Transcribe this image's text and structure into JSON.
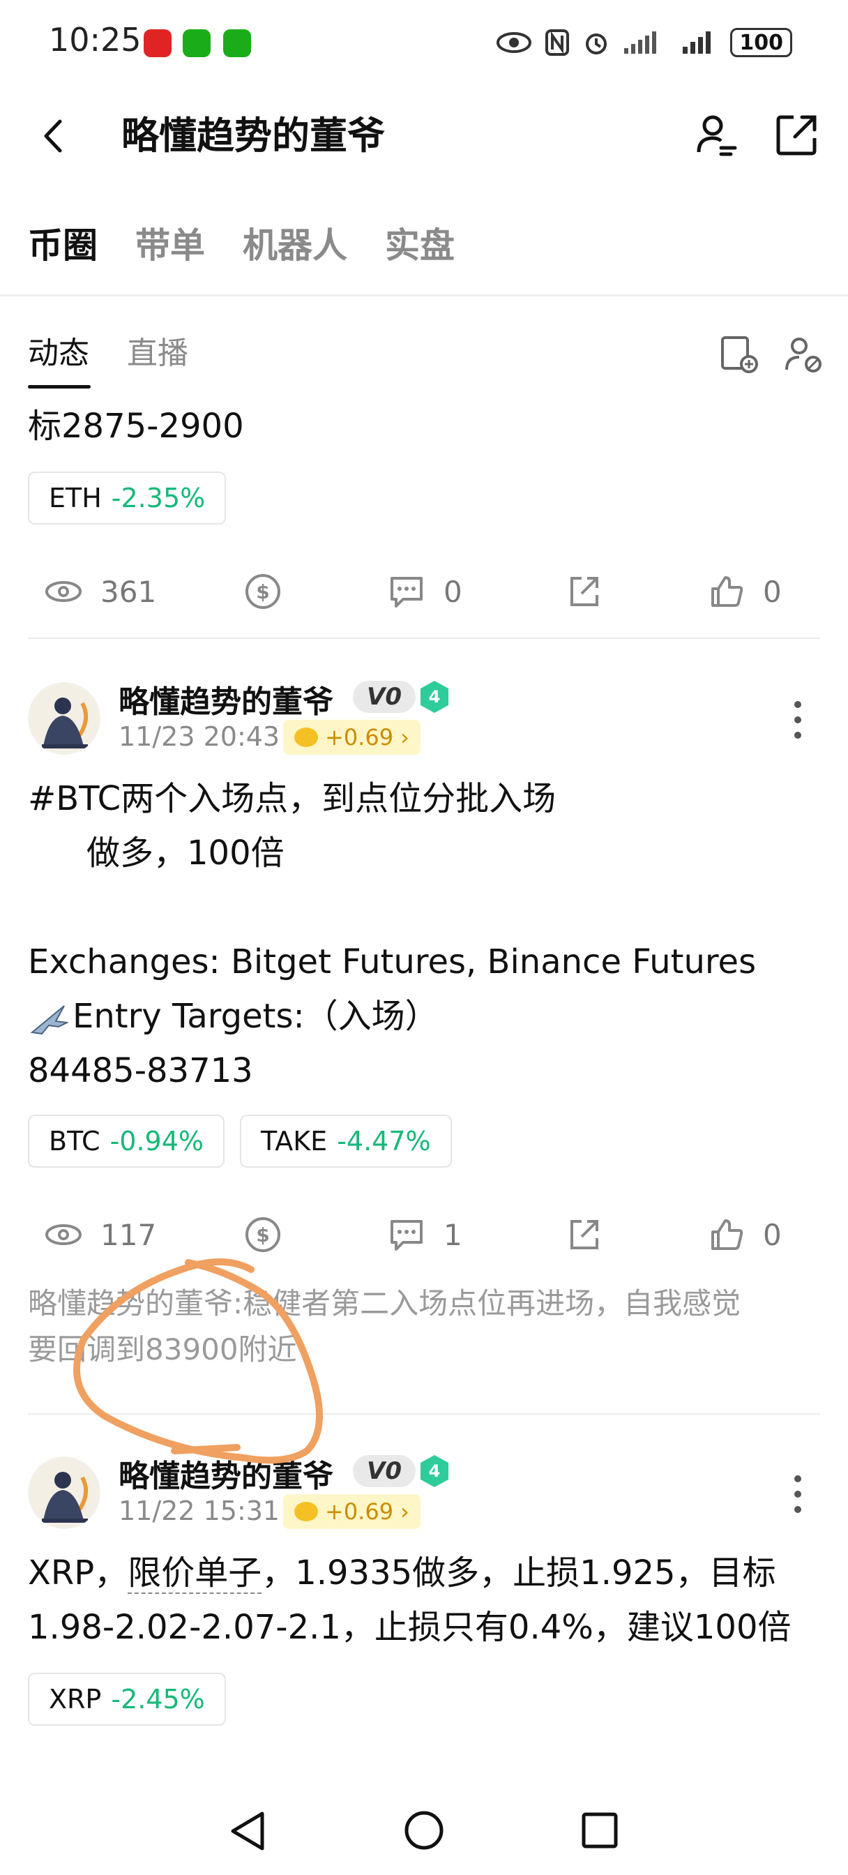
{
  "status_bar": {
    "time": "10:25",
    "battery": "100"
  },
  "header": {
    "title": "略懂趋势的董爷"
  },
  "tabs": [
    "币圈",
    "带单",
    "机器人",
    "实盘"
  ],
  "subtabs": [
    "动态",
    "直播"
  ],
  "post0": {
    "text_tail": "标2875-2900",
    "chip": {
      "symbol": "ETH",
      "change": "-2.35%"
    },
    "views": "361",
    "comments": "0",
    "likes": "0"
  },
  "post1": {
    "author": "略懂趋势的董爷",
    "vip": "V0",
    "level": "4",
    "time": "11/23 20:43",
    "reward": "+0.69",
    "line1": "#BTC两个入场点，到点位分批入场",
    "line2": "做多，100倍",
    "line3": "Exchanges: Bitget Futures, Binance Futures",
    "line4": "Entry Targets:（入场）",
    "line5": "84485-83713",
    "chips": [
      {
        "symbol": "BTC",
        "change": "-0.94%"
      },
      {
        "symbol": "TAKE",
        "change": "-4.47%"
      }
    ],
    "views": "117",
    "comments": "1",
    "likes": "0",
    "comment_line1": "略懂趋势的董爷:稳健者第二入场点位再进场，自我感觉",
    "comment_line2": "要回调到83900附近"
  },
  "post2": {
    "author": "略懂趋势的董爷",
    "vip": "V0",
    "level": "4",
    "time": "11/22 15:31",
    "reward": "+0.69",
    "line1_a": "XRP，",
    "line1_b": "限价单子",
    "line1_c": "，1.9335做多，止损1.925，目标",
    "line2": "1.98-2.02-2.07-2.1，止损只有0.4%，建议100倍",
    "chip": {
      "symbol": "XRP",
      "change": "-2.45%"
    }
  },
  "colors": {
    "accent_green": "#16b979",
    "annotation_orange": "#f0a060"
  },
  "icons": [
    "eye-icon",
    "coin-icon",
    "comment-icon",
    "share-icon",
    "thumbs-up-icon"
  ]
}
